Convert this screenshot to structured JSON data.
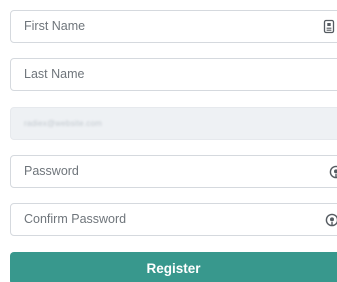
{
  "form": {
    "first_name": {
      "placeholder": "First Name",
      "icon": "id-card-icon"
    },
    "last_name": {
      "placeholder": "Last Name"
    },
    "email": {
      "value": "radiex@website.com",
      "disabled": true
    },
    "password": {
      "placeholder": "Password",
      "icon": "eye-toggle-icon"
    },
    "confirm_password": {
      "placeholder": "Confirm Password",
      "icon": "eye-toggle-icon"
    },
    "register_label": "Register"
  },
  "colors": {
    "accent": "#38988d",
    "border": "#d5d9de",
    "disabled_bg": "#eef1f4",
    "placeholder_text": "#6f757b"
  }
}
